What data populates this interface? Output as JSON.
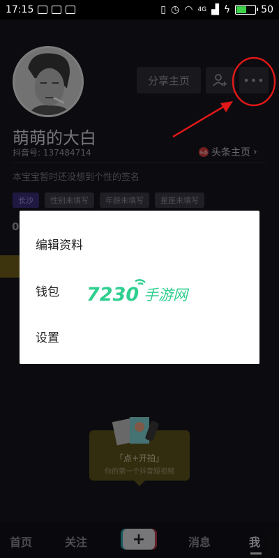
{
  "status_bar": {
    "time": "17:15",
    "network": "4G",
    "battery_level": "50"
  },
  "profile": {
    "name": "萌萌的大白",
    "douyin_id_label": "抖音号:",
    "douyin_id": "137484714",
    "share_button": "分享主页",
    "toutiao_link": "头条主页",
    "toutiao_logo_text": "头条",
    "signature": "本宝宝暂时还没想到个性的签名",
    "tags": [
      "长沙",
      "性别未填写",
      "年龄未填写",
      "星座未填写"
    ],
    "stat_partial": "0"
  },
  "menu": {
    "items": [
      "编辑资料",
      "钱包",
      "设置"
    ]
  },
  "promo": {
    "title": "「点+开拍」",
    "subtitle": "你的第一个抖音短视频"
  },
  "bottom_nav": {
    "items": [
      "首页",
      "关注",
      "消息",
      "我"
    ],
    "plus_label": "+"
  },
  "watermark": {
    "number": "7230",
    "text": "手游网"
  },
  "colors": {
    "annotation_red": "#e01818",
    "accent_yellow": "#ffd21e",
    "tag_purple": "#3a2e78"
  }
}
